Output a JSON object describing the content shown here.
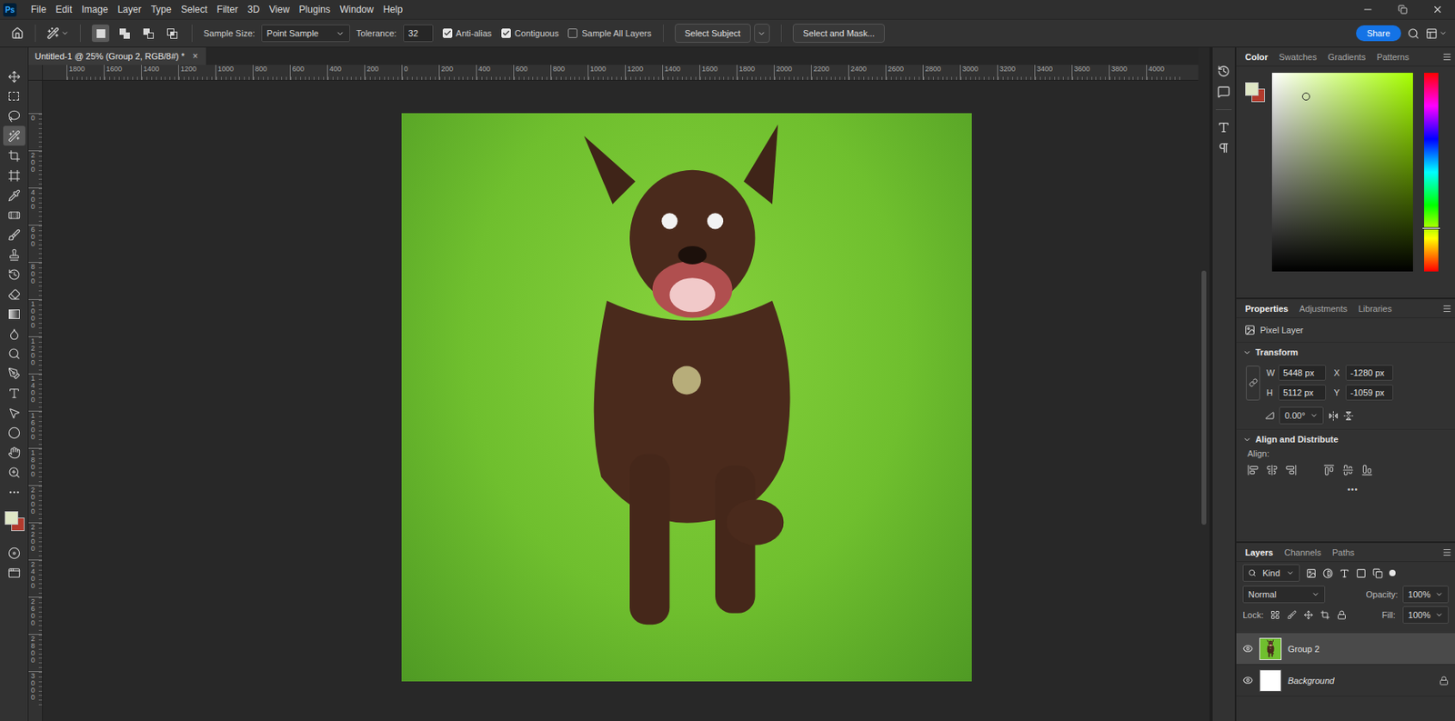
{
  "app": {
    "logo": "Ps",
    "menu": [
      "File",
      "Edit",
      "Image",
      "Layer",
      "Type",
      "Select",
      "Filter",
      "3D",
      "View",
      "Plugins",
      "Window",
      "Help"
    ]
  },
  "options_bar": {
    "selection_modes": [
      {
        "kind": "new",
        "selected": true
      },
      {
        "kind": "add",
        "selected": false
      },
      {
        "kind": "subtract",
        "selected": false
      },
      {
        "kind": "intersect",
        "selected": false
      }
    ],
    "sample_size": {
      "label": "Sample Size:",
      "value": "Point Sample"
    },
    "tolerance": {
      "label": "Tolerance:",
      "value": "32"
    },
    "checkboxes": [
      {
        "label": "Anti-alias",
        "checked": true
      },
      {
        "label": "Contiguous",
        "checked": true
      },
      {
        "label": "Sample All Layers",
        "checked": false
      }
    ],
    "buttons": [
      "Select Subject",
      "Select and Mask..."
    ],
    "share": "Share"
  },
  "tools": [
    {
      "kind": "move",
      "selected": false
    },
    {
      "kind": "marquee",
      "selected": false
    },
    {
      "kind": "lasso",
      "selected": false
    },
    {
      "kind": "wand",
      "selected": true
    },
    {
      "kind": "crop",
      "selected": false
    },
    {
      "kind": "frame",
      "selected": false
    },
    {
      "kind": "eyedropper",
      "selected": false
    },
    {
      "kind": "healing",
      "selected": false
    },
    {
      "kind": "brush",
      "selected": false
    },
    {
      "kind": "stamp",
      "selected": false
    },
    {
      "kind": "history-brush",
      "selected": false
    },
    {
      "kind": "eraser",
      "selected": false
    },
    {
      "kind": "gradient",
      "selected": false
    },
    {
      "kind": "blur",
      "selected": false
    },
    {
      "kind": "dodge",
      "selected": false
    },
    {
      "kind": "pen",
      "selected": false
    },
    {
      "kind": "type",
      "selected": false
    },
    {
      "kind": "path-select",
      "selected": false
    },
    {
      "kind": "shape",
      "selected": false
    },
    {
      "kind": "hand",
      "selected": false
    },
    {
      "kind": "zoom",
      "selected": false
    },
    {
      "kind": "more",
      "selected": false
    }
  ],
  "bottom_tools": [
    {
      "kind": "quick-mask",
      "selected": false
    },
    {
      "kind": "screen-mode",
      "selected": false
    }
  ],
  "colors": {
    "foreground": "#dfe7c5",
    "background": "#b23a2c"
  },
  "document": {
    "tab": "Untitled-1 @ 25% (Group 2, RGB/8#) *",
    "close": "×",
    "selected": true
  },
  "rulers": {
    "horizontal": [
      "1800",
      "1600",
      "1400",
      "1200",
      "1000",
      "800",
      "600",
      "400",
      "200",
      "0",
      "200",
      "400",
      "600",
      "800",
      "1000",
      "1200",
      "1400",
      "1600",
      "1800",
      "2000",
      "2200",
      "2400",
      "2600",
      "2800",
      "3000",
      "3200",
      "3400",
      "3600",
      "3800",
      "4000"
    ],
    "vertical": [
      "0",
      "200",
      "400",
      "600",
      "800",
      "1000",
      "1200",
      "1400",
      "1600",
      "1800",
      "2000",
      "2200",
      "2400",
      "2600",
      "2800",
      "3000"
    ]
  },
  "vertical_scrollbar": {
    "start": 0.33,
    "size": 0.38
  },
  "color_panel": {
    "tabs": [
      {
        "label": "Color",
        "selected": true
      },
      {
        "label": "Swatches",
        "selected": false
      },
      {
        "label": "Gradients",
        "selected": false
      },
      {
        "label": "Patterns",
        "selected": false
      }
    ],
    "picker": {
      "hue": "#a6ff00",
      "x": 0.24,
      "y": 0.12,
      "hue_position": 0.78
    }
  },
  "properties_panel": {
    "tabs": [
      {
        "label": "Properties",
        "selected": true
      },
      {
        "label": "Adjustments",
        "selected": false
      },
      {
        "label": "Libraries",
        "selected": false
      }
    ],
    "layer_type": "Pixel Layer",
    "transform": {
      "title": "Transform",
      "expanded": true,
      "linked": true,
      "fields": [
        {
          "label": "W",
          "value": "5448 px"
        },
        {
          "label": "X",
          "value": "-1280 px"
        },
        {
          "label": "H",
          "value": "5112 px"
        },
        {
          "label": "Y",
          "value": "-1059 px"
        }
      ],
      "angle": "0.00°"
    },
    "align": {
      "title": "Align and Distribute",
      "expanded": true,
      "label": "Align:",
      "more": "•••"
    }
  },
  "layers_panel": {
    "tabs": [
      {
        "label": "Layers",
        "selected": true
      },
      {
        "label": "Channels",
        "selected": false
      },
      {
        "label": "Paths",
        "selected": false
      }
    ],
    "filter": "Kind",
    "blend_mode": "Normal",
    "opacity": {
      "label": "Opacity:",
      "value": "100%"
    },
    "lock_label": "Lock:",
    "fill": {
      "label": "Fill:",
      "value": "100%"
    },
    "layers": [
      {
        "name": "Group 2",
        "kind": "photo",
        "visible": true,
        "selected": true,
        "locked": false
      },
      {
        "name": "Background",
        "kind": "white",
        "visible": true,
        "selected": false,
        "locked": true
      }
    ]
  }
}
